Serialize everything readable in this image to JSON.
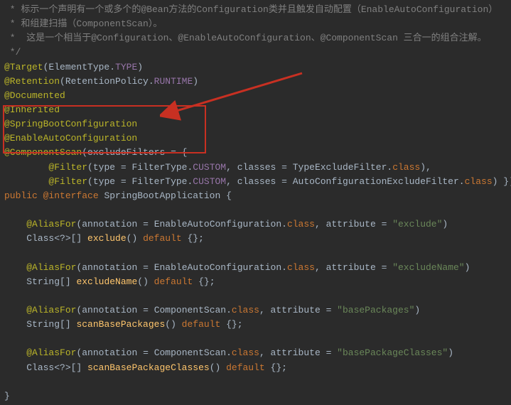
{
  "comments": {
    "c1": " * 标示一个声明有一个或多个的@Bean方法的Configuration类并且触发自动配置（EnableAutoConfiguration）",
    "c2": " * 和组建扫描（ComponentScan）。",
    "c3": " *  这是一个相当于@Configuration、@EnableAutoConfiguration、@ComponentScan 三合一的组合注解。",
    "c4": " */"
  },
  "code": {
    "target_at": "@Target",
    "target_open": "(",
    "target_val_cls": "ElementType",
    "target_dot": ".",
    "target_field": "TYPE",
    "target_close": ")",
    "retention_at": "@Retention",
    "retention_open": "(",
    "retention_cls": "RetentionPolicy",
    "retention_dot": ".",
    "retention_field": "RUNTIME",
    "retention_close": ")",
    "documented": "@Documented",
    "inherited": "@Inherited",
    "sbc": "@SpringBootConfiguration",
    "eac": "@EnableAutoConfiguration",
    "cs_at": "@ComponentScan",
    "cs_open": "(",
    "cs_attr": "excludeFilters ",
    "cs_eq": "= {",
    "f1_pad": "        ",
    "f1_at": "@Filter",
    "f1_open": "(",
    "f1_k1": "type ",
    "f1_eq1": "= ",
    "f1_cls1": "FilterType",
    "f1_dot1": ".",
    "f1_fld1": "CUSTOM",
    "f1_sep": ", ",
    "f1_k2": "classes ",
    "f1_eq2": "= ",
    "f1_cls2": "TypeExcludeFilter",
    "f1_dot2": ".",
    "f1_kw": "class",
    "f1_close": "),",
    "f2_pad": "        ",
    "f2_at": "@Filter",
    "f2_open": "(",
    "f2_k1": "type ",
    "f2_eq1": "= ",
    "f2_cls1": "FilterType",
    "f2_dot1": ".",
    "f2_fld1": "CUSTOM",
    "f2_sep": ", ",
    "f2_k2": "classes ",
    "f2_eq2": "= ",
    "f2_cls2": "AutoConfigurationExcludeFilter",
    "f2_dot2": ".",
    "f2_kw": "class",
    "f2_close": ") })",
    "decl_kw1": "public ",
    "decl_at": "@interface ",
    "decl_name": "SpringBootApplication ",
    "decl_open": "{",
    "m1_pad": "    ",
    "m1_at": "@AliasFor",
    "m1_open": "(",
    "m1_k1": "annotation ",
    "m1_eq1": "= ",
    "m1_cls": "EnableAutoConfiguration",
    "m1_dot": ".",
    "m1_kw": "class",
    "m1_sep": ", ",
    "m1_k2": "attribute ",
    "m1_eq2": "= ",
    "m1_str": "\"exclude\"",
    "m1_close": ")",
    "m1b_pad": "    ",
    "m1b_type": "Class<?>[] ",
    "m1b_name": "exclude",
    "m1b_paren": "() ",
    "m1b_kw": "default ",
    "m1b_val": "{};",
    "m2_pad": "    ",
    "m2_at": "@AliasFor",
    "m2_open": "(",
    "m2_k1": "annotation ",
    "m2_eq1": "= ",
    "m2_cls": "EnableAutoConfiguration",
    "m2_dot": ".",
    "m2_kw": "class",
    "m2_sep": ", ",
    "m2_k2": "attribute ",
    "m2_eq2": "= ",
    "m2_str": "\"excludeName\"",
    "m2_close": ")",
    "m2b_pad": "    ",
    "m2b_type": "String[] ",
    "m2b_name": "excludeName",
    "m2b_paren": "() ",
    "m2b_kw": "default ",
    "m2b_val": "{};",
    "m3_pad": "    ",
    "m3_at": "@AliasFor",
    "m3_open": "(",
    "m3_k1": "annotation ",
    "m3_eq1": "= ",
    "m3_cls": "ComponentScan",
    "m3_dot": ".",
    "m3_kw": "class",
    "m3_sep": ", ",
    "m3_k2": "attribute ",
    "m3_eq2": "= ",
    "m3_str": "\"basePackages\"",
    "m3_close": ")",
    "m3b_pad": "    ",
    "m3b_type": "String[] ",
    "m3b_name": "scanBasePackages",
    "m3b_paren": "() ",
    "m3b_kw": "default ",
    "m3b_val": "{};",
    "m4_pad": "    ",
    "m4_at": "@AliasFor",
    "m4_open": "(",
    "m4_k1": "annotation ",
    "m4_eq1": "= ",
    "m4_cls": "ComponentScan",
    "m4_dot": ".",
    "m4_kw": "class",
    "m4_sep": ", ",
    "m4_k2": "attribute ",
    "m4_eq2": "= ",
    "m4_str": "\"basePackageClasses\"",
    "m4_close": ")",
    "m4b_pad": "    ",
    "m4b_type": "Class<?>[] ",
    "m4b_name": "scanBasePackageClasses",
    "m4b_paren": "() ",
    "m4b_kw": "default ",
    "m4b_val": "{};",
    "end": "}"
  },
  "colors": {
    "highlight_border": "#c83022",
    "arrow": "#c83022"
  }
}
